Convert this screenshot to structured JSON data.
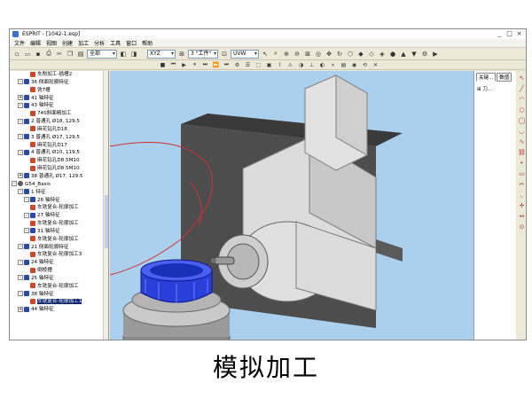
{
  "window": {
    "title": "ESPRIT - [1042-1.esp]",
    "controls": [
      "_",
      "□",
      "×"
    ]
  },
  "menu": [
    "文件",
    "编辑",
    "视图",
    "创建",
    "加工",
    "分析",
    "工具",
    "窗口",
    "帮助"
  ],
  "toolbar": {
    "layer_combo": "全部",
    "plane_combo": "XYZ",
    "workplane_combo": "3 \"工件\"",
    "uvw_combo": "UVW"
  },
  "tree": [
    {
      "label": "车削加工-插槽2",
      "kind": "op",
      "indent": 3,
      "exp": ""
    },
    {
      "label": "36 侧面轮廓特征",
      "kind": "feat",
      "indent": 1,
      "exp": "-"
    },
    {
      "label": "铣T槽",
      "kind": "op",
      "indent": 3,
      "exp": ""
    },
    {
      "label": "41 轴特征",
      "kind": "feat",
      "indent": 1,
      "exp": "+"
    },
    {
      "label": "43 轴特征",
      "kind": "feat",
      "indent": 1,
      "exp": "-"
    },
    {
      "label": "74S斜面精加工",
      "kind": "op",
      "indent": 3,
      "exp": ""
    },
    {
      "label": "2 普通孔 Ø18, 129.5",
      "kind": "feat",
      "indent": 1,
      "exp": "-"
    },
    {
      "label": "麻花钻孔D18",
      "kind": "op",
      "indent": 3,
      "exp": ""
    },
    {
      "label": "3 普通孔 Ø17, 129.5",
      "kind": "feat",
      "indent": 1,
      "exp": "-"
    },
    {
      "label": "麻花钻孔D17",
      "kind": "op",
      "indent": 3,
      "exp": ""
    },
    {
      "label": "4 普通孔 Ø10, 119.5",
      "kind": "feat",
      "indent": 1,
      "exp": "-"
    },
    {
      "label": "麻花钻孔D8.5M10",
      "kind": "op",
      "indent": 3,
      "exp": ""
    },
    {
      "label": "麻花钻孔D8.5M10",
      "kind": "op",
      "indent": 3,
      "exp": ""
    },
    {
      "label": "38 普通孔 Ø17, 129.5",
      "kind": "feat",
      "indent": 1,
      "exp": "+"
    },
    {
      "label": "G54_Basis",
      "kind": "tool",
      "indent": 0,
      "exp": "-"
    },
    {
      "label": "1 特征",
      "kind": "feat",
      "indent": 1,
      "exp": "-"
    },
    {
      "label": "28 轴特征",
      "kind": "feat",
      "indent": 2,
      "exp": "-"
    },
    {
      "label": "车铣复合-轮廓加工",
      "kind": "op",
      "indent": 3,
      "exp": ""
    },
    {
      "label": "27 轴特征",
      "kind": "feat",
      "indent": 2,
      "exp": "-"
    },
    {
      "label": "车铣复合-轮廓加工",
      "kind": "op",
      "indent": 3,
      "exp": ""
    },
    {
      "label": "31 轴特征",
      "kind": "feat",
      "indent": 2,
      "exp": "-"
    },
    {
      "label": "车铣复合-轮廓加工",
      "kind": "op",
      "indent": 3,
      "exp": ""
    },
    {
      "label": "21 侧面轮廓特征",
      "kind": "feat",
      "indent": 1,
      "exp": "-"
    },
    {
      "label": "车铣复合-轮廓加工3",
      "kind": "op",
      "indent": 3,
      "exp": ""
    },
    {
      "label": "24 轴特征",
      "kind": "feat",
      "indent": 1,
      "exp": "-"
    },
    {
      "label": "倒棱槽",
      "kind": "op",
      "indent": 3,
      "exp": ""
    },
    {
      "label": "25 轴特征",
      "kind": "feat",
      "indent": 1,
      "exp": "-"
    },
    {
      "label": "车铣复合-轮廓加工",
      "kind": "op",
      "indent": 3,
      "exp": ""
    },
    {
      "label": "38 轴特征",
      "kind": "feat",
      "indent": 1,
      "exp": "-"
    },
    {
      "label": "车铣复合-轮廓加工1",
      "kind": "op",
      "indent": 3,
      "exp": "",
      "selected": true
    },
    {
      "label": "44 轴特征",
      "kind": "feat",
      "indent": 1,
      "exp": "+"
    }
  ],
  "right_panel": {
    "tabs": [
      "关键...",
      "数值"
    ],
    "item": "刀..."
  },
  "colors": {
    "viewport_bg": "#aad0ee",
    "selection": "#0a246a",
    "part_blue": "#2a3fd8"
  },
  "caption": "模拟加工"
}
